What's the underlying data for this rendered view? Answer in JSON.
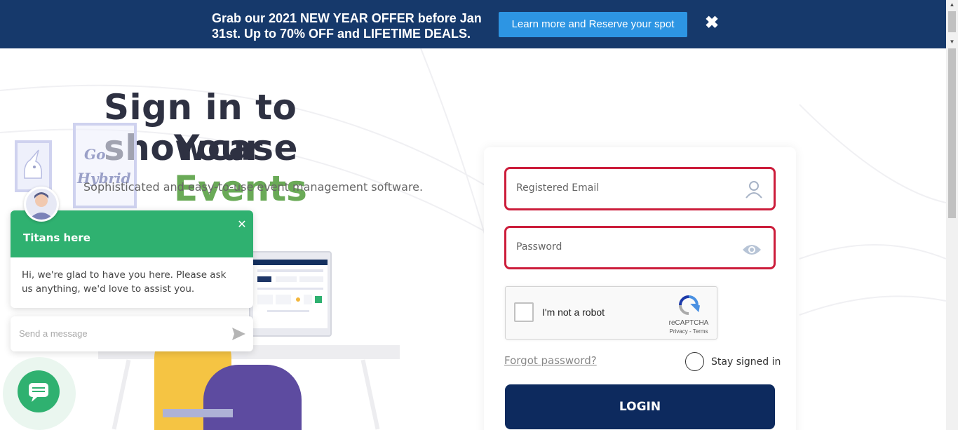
{
  "banner": {
    "line1": "Grab our 2021 NEW YEAR OFFER before Jan",
    "line2": "31st. Up to 70% OFF and LIFETIME DEALS.",
    "cta_label": "Learn more and Reserve your spot",
    "close_icon": "close-icon",
    "bg_color": "#16396b",
    "cta_color": "#2d95e3"
  },
  "hero": {
    "line1": "Sign in to showcase",
    "line2_prefix": "Your ",
    "line2_accent": "Events",
    "subtitle": "Sophisticated and easy-to-use event management software.",
    "accent_color": "#6aaa57"
  },
  "decor": {
    "frame_text_1": "Go",
    "frame_text_2": "Hybrid"
  },
  "chat": {
    "title": "Titans here",
    "message": "Hi, we're glad to have you here. Please ask us anything, we'd love to assist you.",
    "input_placeholder": "Send a message",
    "brand_color": "#2fb170",
    "icons": [
      "close-icon",
      "send-icon",
      "chat-bubble-icon",
      "avatar"
    ]
  },
  "login": {
    "email_label": "Registered Email",
    "password_label": "Password",
    "email_icon": "user-icon",
    "password_icon": "eye-icon",
    "error_border_color": "#cc1d3b",
    "recaptcha": {
      "label": "I'm not a robot",
      "brand": "reCAPTCHA",
      "terms": "Privacy - Terms"
    },
    "forgot_label": "Forgot password?",
    "stay_signed_label": "Stay signed in",
    "submit_label": "LOGIN",
    "submit_color": "#0d2a5e"
  }
}
